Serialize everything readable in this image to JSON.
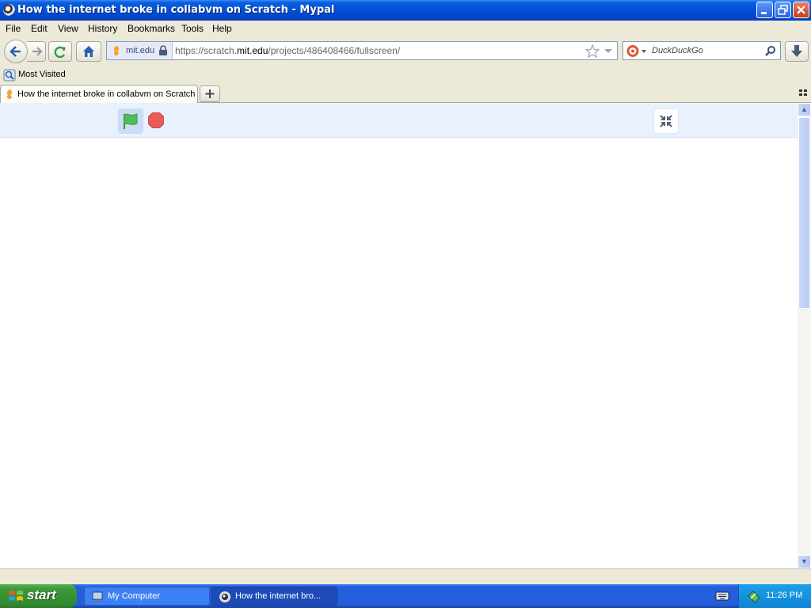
{
  "window": {
    "title": "How the internet broke in collabvm on Scratch - Mypal"
  },
  "menu": [
    "File",
    "Edit",
    "View",
    "History",
    "Bookmarks",
    "Tools",
    "Help"
  ],
  "urlbar": {
    "identity": "mit.edu",
    "url_prefix": "https://scratch.",
    "url_host": "mit.edu",
    "url_path": "/projects/486408466/fullscreen/"
  },
  "search": {
    "placeholder": "DuckDuckGo"
  },
  "bookmarks": {
    "most_visited": "Most Visited"
  },
  "tabs": [
    {
      "label": "How the internet broke in collabvm on Scratch"
    }
  ],
  "taskbar": {
    "start": "start",
    "tasks": [
      {
        "label": "My Computer"
      },
      {
        "label": "How the internet bro..."
      }
    ],
    "clock": "11:26 PM"
  },
  "colors": {
    "titlebar": "#0050d8",
    "scratch_bar": "#e9f1fc",
    "green_flag": "#4cbf56",
    "stop_sign": "#ec5959",
    "taskbar": "#245edc",
    "start": "#3c9a3b"
  }
}
